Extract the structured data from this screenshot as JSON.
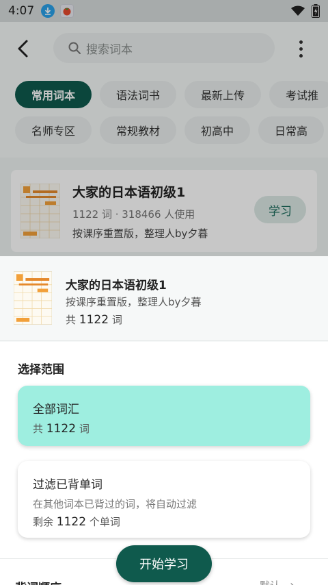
{
  "status_bar": {
    "time": "4:07",
    "icons": [
      "download-icon",
      "tomato-app-icon",
      "wifi-icon",
      "battery-icon"
    ]
  },
  "top_bar": {
    "search_placeholder": "搜索词本",
    "icons": [
      "back-arrow-icon",
      "search-icon",
      "more-vert-icon"
    ]
  },
  "categories_row1": [
    "常用词本",
    "语法词书",
    "最新上传",
    "考试推"
  ],
  "categories_row2": [
    "名师专区",
    "常规教材",
    "初高中",
    "日常高"
  ],
  "active_category": "常用词本",
  "book_card": {
    "title": "大家的日本语初级1",
    "meta": "1122 词 · 318466 人使用",
    "desc": "按课序重置版，整理人by夕暮",
    "learn_label": "学习"
  },
  "sheet": {
    "title": "大家的日本语初级1",
    "desc": "按课序重置版，整理人by夕暮",
    "count_prefix": "共",
    "count": "1122",
    "count_unit": "词",
    "range_label": "选择范围",
    "options": [
      {
        "title": "全部词汇",
        "count_prefix": "共",
        "count": "1122",
        "count_unit": "词",
        "selected": true
      },
      {
        "title": "过滤已背单词",
        "desc": "在其他词本已背过的词，将自动过滤",
        "count_prefix": "剩余",
        "count": "1122",
        "count_unit": "个单词",
        "selected": false
      }
    ],
    "order_label": "背词顺序",
    "order_value": "默认",
    "start_label": "开始学习"
  },
  "colors": {
    "accent": "#0f5a4d",
    "selected_option": "#9eeee0",
    "download": "#2aa0e8"
  }
}
